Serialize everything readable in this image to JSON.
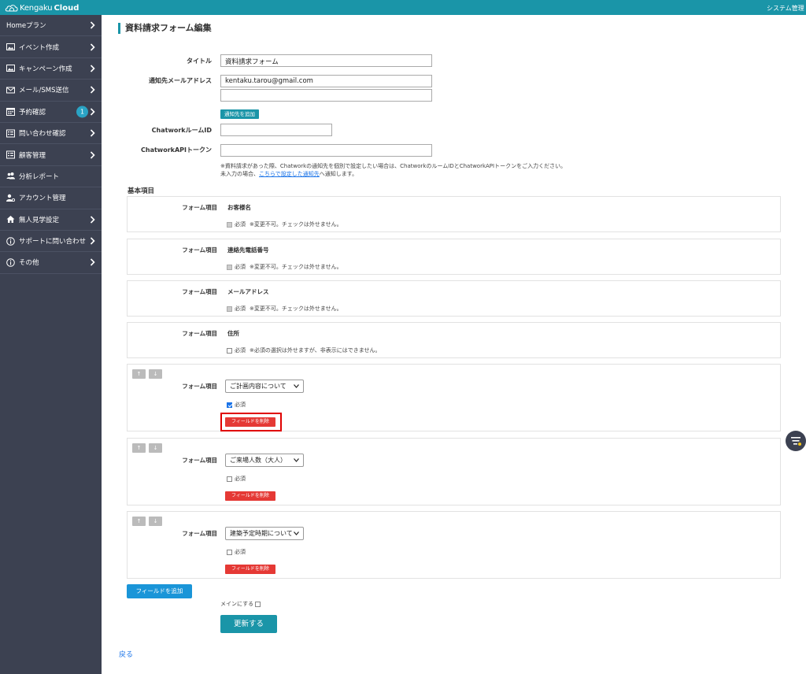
{
  "app": {
    "logo_part1": "Kengaku",
    "logo_part2": "Cloud",
    "user_label": "システム管理者"
  },
  "sidebar": {
    "items": [
      {
        "label": "Homeプラン",
        "icon": "none",
        "chevron": true
      },
      {
        "label": "イベント作成",
        "icon": "image-icon",
        "chevron": true
      },
      {
        "label": "キャンペーン作成",
        "icon": "image-icon",
        "chevron": true
      },
      {
        "label": "メール/SMS送信",
        "icon": "envelope-icon",
        "chevron": true
      },
      {
        "label": "予約確認",
        "icon": "calendar-icon",
        "chevron": true,
        "badge": "1"
      },
      {
        "label": "問い合わせ確認",
        "icon": "list-icon",
        "chevron": true
      },
      {
        "label": "顧客管理",
        "icon": "list-icon",
        "chevron": true
      },
      {
        "label": "分析レポート",
        "icon": "users-icon",
        "chevron": false
      },
      {
        "label": "アカウント管理",
        "icon": "user-gear-icon",
        "chevron": false
      },
      {
        "label": "無人見学設定",
        "icon": "home-icon",
        "chevron": true
      },
      {
        "label": "サポートに問い合わせ",
        "icon": "info-icon",
        "chevron": true
      },
      {
        "label": "その他",
        "icon": "info-icon",
        "chevron": true
      }
    ]
  },
  "page": {
    "title": "資料請求フォーム編集"
  },
  "form": {
    "title_label": "タイトル",
    "title_value": "資料請求フォーム",
    "email_label": "通知先メールアドレス",
    "email_value_1": "kentaku.tarou@gmail.com",
    "email_value_2": "",
    "add_notify_label": "通知先を追加",
    "chatwork_room_label": "ChatworkルームID",
    "chatwork_room_value": "",
    "chatwork_token_label": "ChatworkAPIトークン",
    "chatwork_token_value": "",
    "note_line1": "※資料請求があった際、Chatworkの通知先を個別で設定したい場合は、ChatworkのルームIDとChatworkAPIトークンをご入力ください。",
    "note_line2_pre": "未入力の場合、",
    "note_line2_link": "こちらで設定した通知先",
    "note_line2_post": "へ通知します。"
  },
  "basic": {
    "section_title": "基本項目",
    "field_label": "フォーム項目",
    "required_label": "必須",
    "fixed_items": [
      {
        "name": "お客様名",
        "note": "※変更不可。チェックは外せません。"
      },
      {
        "name": "連絡先電話番号",
        "note": "※変更不可。チェックは外せません。"
      },
      {
        "name": "メールアドレス",
        "note": "※変更不可。チェックは外せません。"
      },
      {
        "name": "住所",
        "note": "※必須の選択は外せますが、非表示にはできません。"
      }
    ],
    "custom_items": [
      {
        "selected": "ご計画内容について",
        "required": true
      },
      {
        "selected": "ご来場人数（大人）",
        "required": false
      },
      {
        "selected": "建築予定時期について",
        "required": false
      }
    ],
    "up_arrow": "↑",
    "down_arrow": "↓",
    "delete_label": "フィールドを削除"
  },
  "actions": {
    "add_field_label": "フィールドを追加",
    "main_label": "メインにする",
    "update_label": "更新する",
    "back_label": "戻る"
  },
  "colors": {
    "brand": "#1a95a8",
    "sidebar": "#3c4151",
    "danger": "#e53935",
    "highlight": "#e00000"
  }
}
